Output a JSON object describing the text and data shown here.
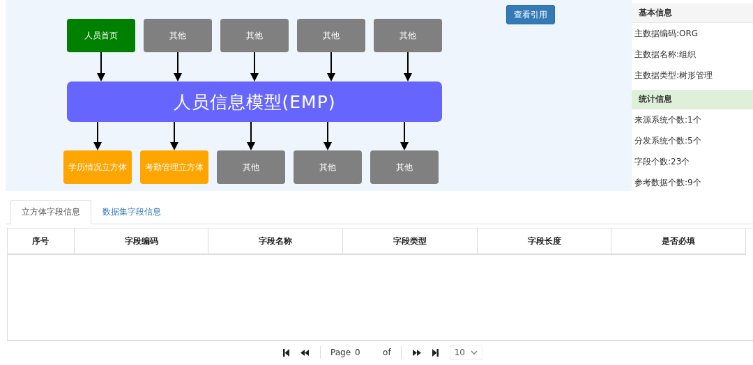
{
  "diagram": {
    "top_nodes": [
      {
        "label": "人员首页",
        "color": "#008000"
      },
      {
        "label": "其他",
        "color": "#808080"
      },
      {
        "label": "其他",
        "color": "#808080"
      },
      {
        "label": "其他",
        "color": "#808080"
      },
      {
        "label": "其他",
        "color": "#808080"
      }
    ],
    "model": {
      "label": "人员信息模型(EMP)"
    },
    "bottom_nodes": [
      {
        "label": "学历情况立方体",
        "color": "#ffa500"
      },
      {
        "label": "考勤管理立方体",
        "color": "#ffa500"
      },
      {
        "label": "其他",
        "color": "#808080"
      },
      {
        "label": "其他",
        "color": "#808080"
      },
      {
        "label": "其他",
        "color": "#808080"
      }
    ]
  },
  "view_references_button": "查看引用",
  "info_panel": {
    "sections": [
      {
        "title": "基本信息",
        "kind": "basic",
        "items": [
          "主数据编码:ORG",
          "主数据名称:组织",
          "主数据类型:树形管理"
        ]
      },
      {
        "title": "统计信息",
        "kind": "stats",
        "items": [
          "来源系统个数:1个",
          "分发系统个数:5个",
          "字段个数:23个",
          "参考数据个数:9个"
        ]
      }
    ]
  },
  "tabs": [
    {
      "label": "立方体字段信息",
      "selected": true
    },
    {
      "label": "数据集字段信息",
      "selected": false
    }
  ],
  "table": {
    "columns": [
      "序号",
      "字段编码",
      "字段名称",
      "字段类型",
      "字段长度",
      "是否必填"
    ]
  },
  "pager": {
    "page_label": "Page",
    "page_value": "0",
    "of_label": "of",
    "page_size": "10"
  }
}
